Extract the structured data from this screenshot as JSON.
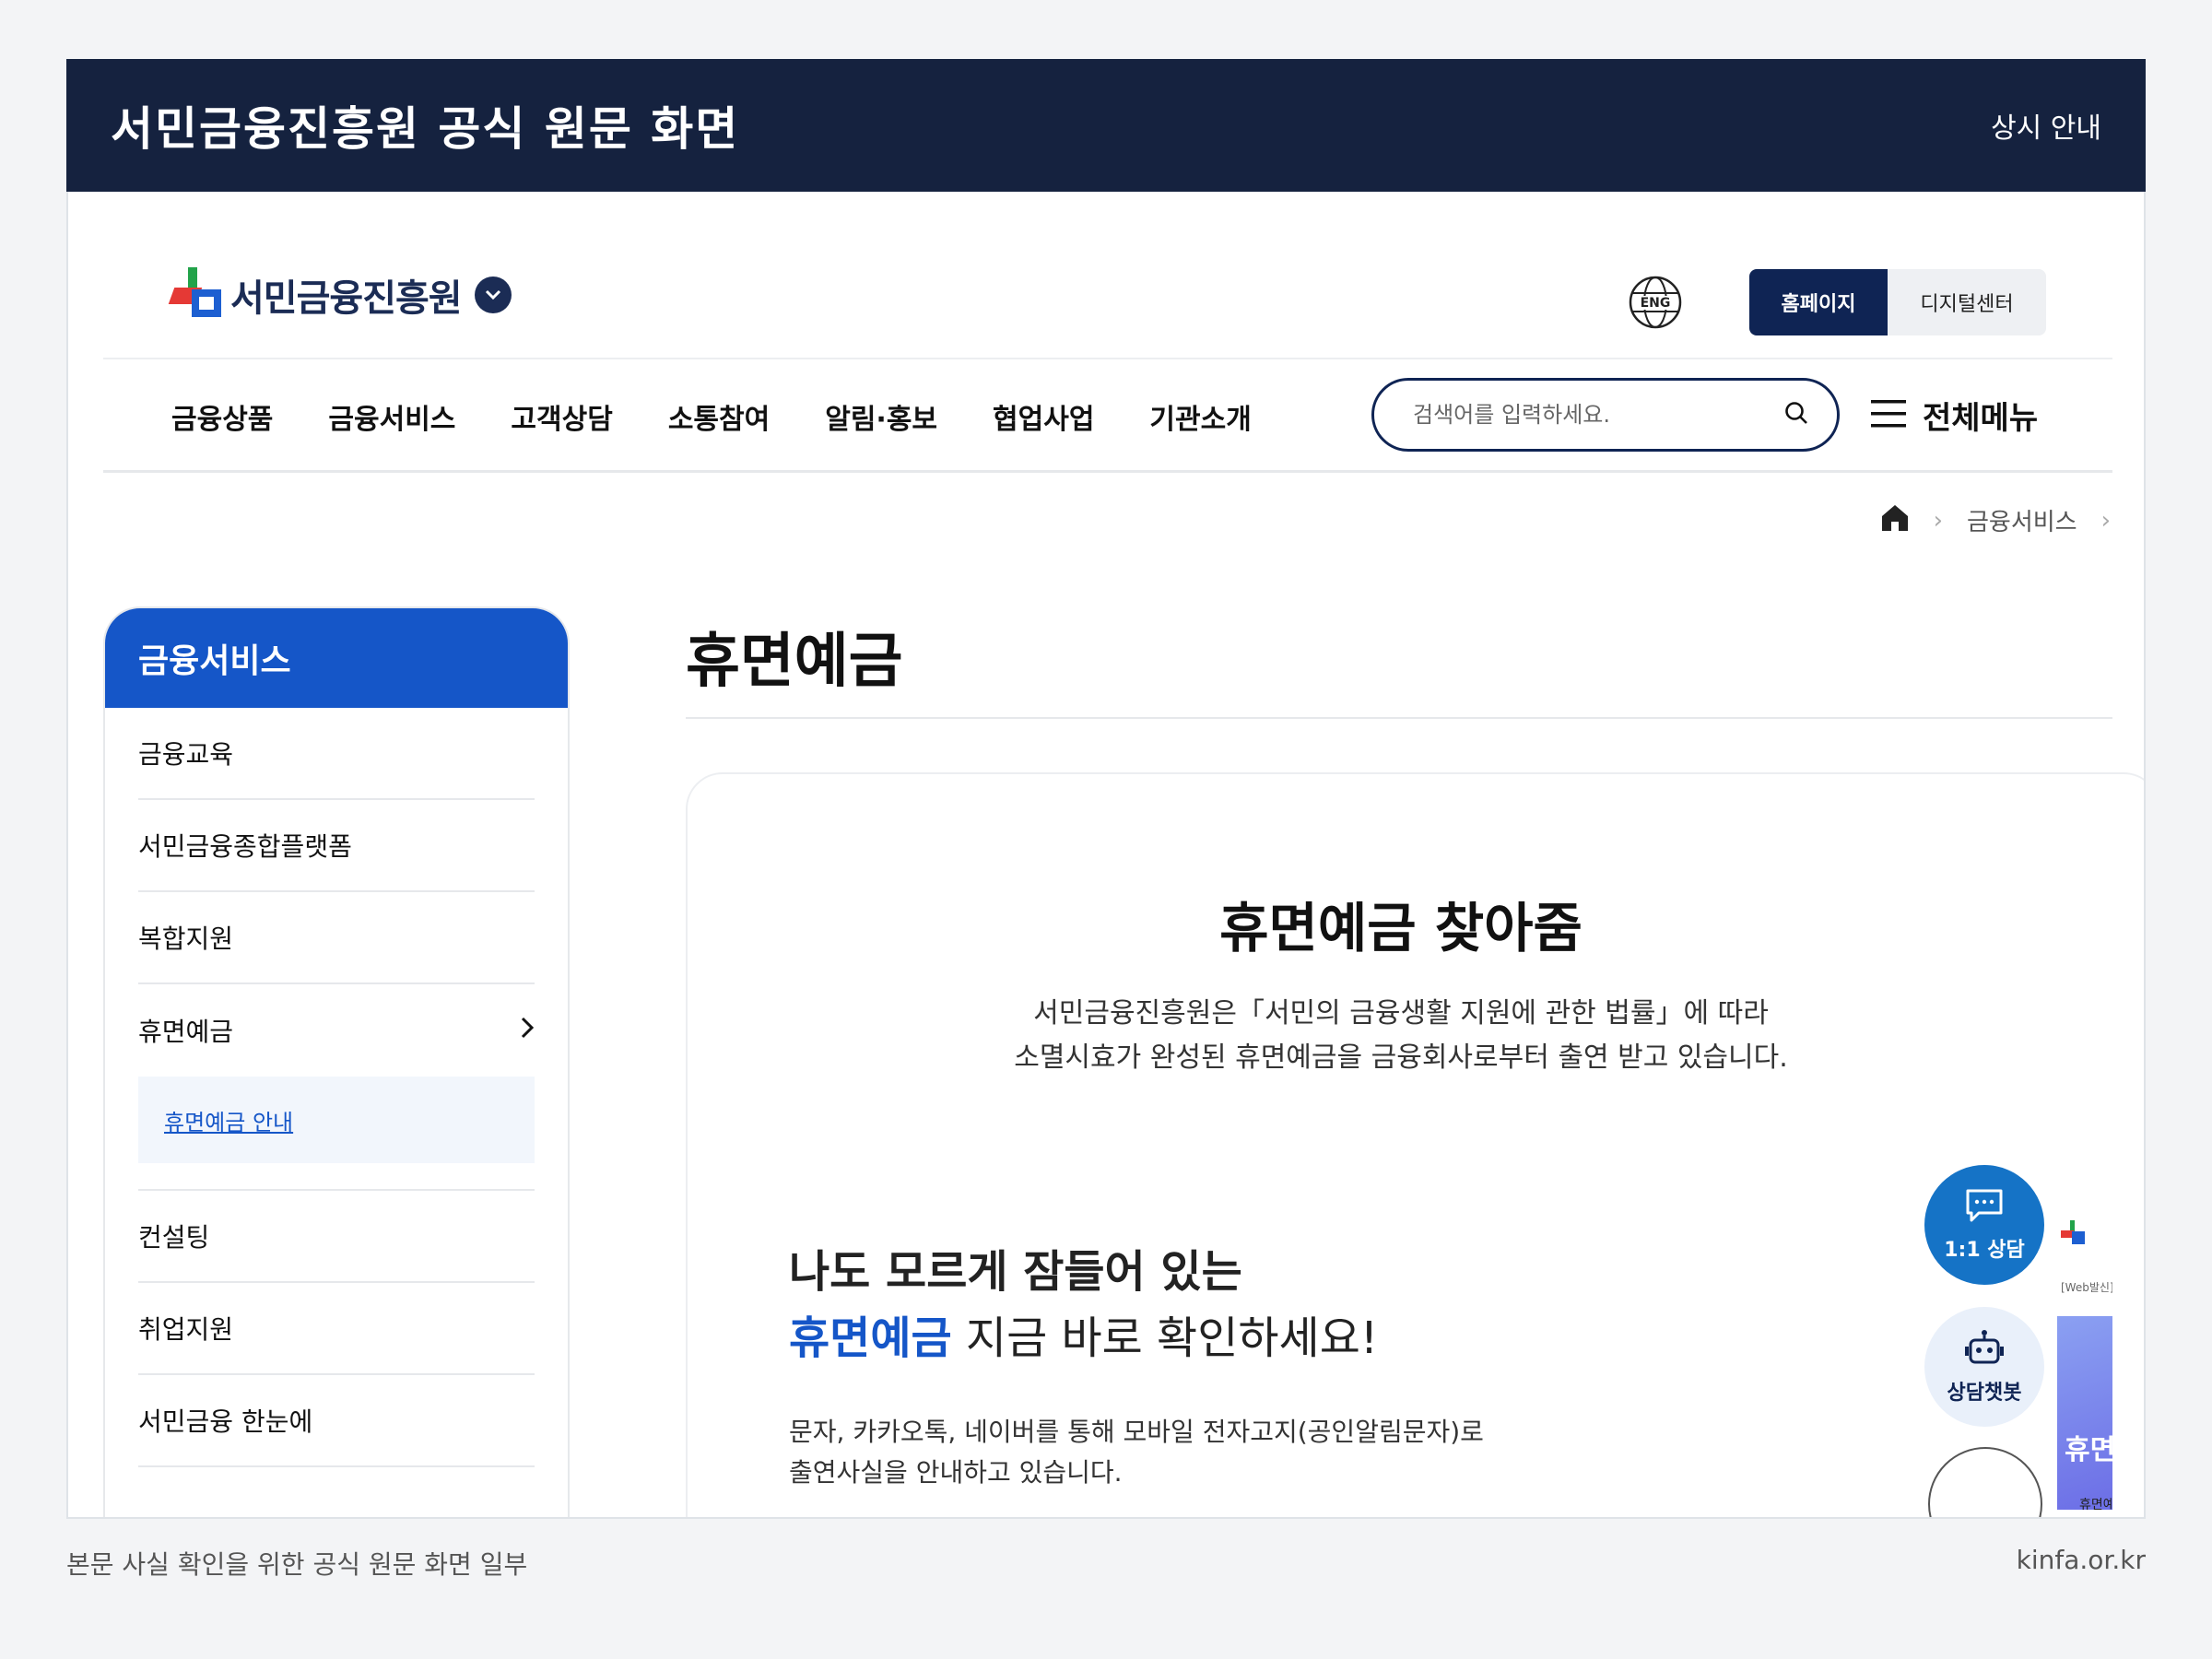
{
  "banner": {
    "title": "서민금융진흥원 공식 원문 화면",
    "right_label": "상시 안내"
  },
  "caption": {
    "left": "본문 사실 확인을 위한 공식 원문 화면 일부",
    "right": "kinfa.or.kr"
  },
  "header": {
    "logo_text": "서민금융진흥원",
    "globe_label": "ENG",
    "toggle": {
      "active": "홈페이지",
      "inactive": "디지털센터"
    }
  },
  "gnb": {
    "items": [
      "금융상품",
      "금융서비스",
      "고객상담",
      "소통참여",
      "알림·홍보",
      "협업사업",
      "기관소개"
    ]
  },
  "search": {
    "placeholder": "검색어를 입력하세요.",
    "all_menu": "전체메뉴"
  },
  "breadcrumb": {
    "current": "금융서비스"
  },
  "lnb": {
    "title": "금융서비스",
    "items": [
      "금융교육",
      "서민금융종합플랫폼",
      "복합지원",
      "휴면예금",
      "컨설팅",
      "취업지원",
      "서민금융 한눈에"
    ],
    "sub_item": "휴면예금 안내"
  },
  "content": {
    "page_title": "휴면예금",
    "card_title": "휴면예금 찾아줌",
    "desc_line1": "서민금융진흥원은「서민의 금융생활 지원에 관한 법률」에 따라",
    "desc_line2": "소멸시효가 완성된 휴면예금을 금융회사로부터 출연 받고 있습니다.",
    "hook_line1": "나도 모르게 잠들어 있는",
    "hook_emphasis": "휴면예금",
    "hook_line2_rest": "지금 바로 확인하세요!",
    "note_line1": "문자, 카카오톡, 네이버를 통해 모바일 전자고지(공인알림문자)로",
    "note_line2": "출연사실을 안내하고 있습니다."
  },
  "floating": {
    "chat_label": "1:1 상담",
    "bot_label": "상담챗봇"
  },
  "promo": {
    "tag": "[Web발신]",
    "big": "휴면",
    "small": "휴면예"
  },
  "colors": {
    "navy": "#15223f",
    "accent_blue": "#1556c8",
    "fab_blue": "#1573c6"
  }
}
